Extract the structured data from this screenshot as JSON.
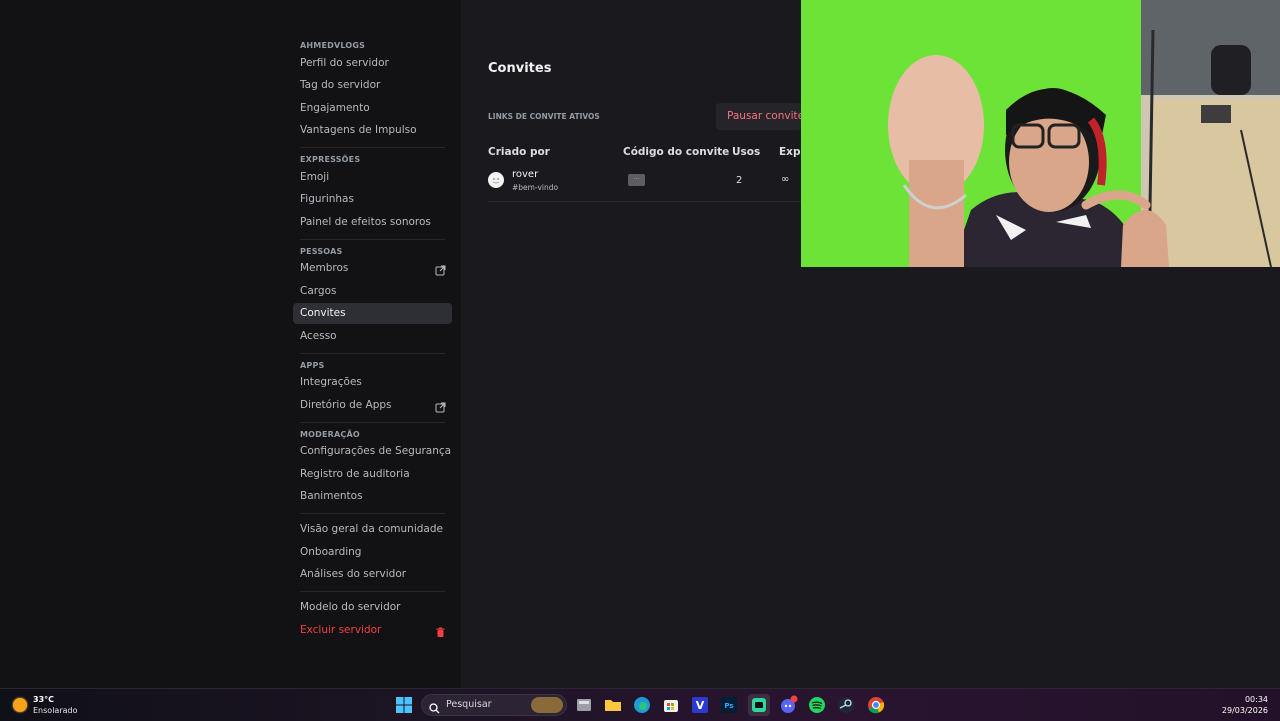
{
  "sidebar": {
    "sections": [
      {
        "header": "AHMEDVLOGS",
        "items": [
          {
            "label": "Perfil do servidor"
          },
          {
            "label": "Tag do servidor"
          },
          {
            "label": "Engajamento"
          },
          {
            "label": "Vantagens de Impulso"
          }
        ]
      },
      {
        "header": "EXPRESSÕES",
        "items": [
          {
            "label": "Emoji"
          },
          {
            "label": "Figurinhas"
          },
          {
            "label": "Painel de efeitos sonoros"
          }
        ]
      },
      {
        "header": "PESSOAS",
        "items": [
          {
            "label": "Membros",
            "trail_icon": "external-link-icon"
          },
          {
            "label": "Cargos"
          },
          {
            "label": "Convites",
            "active": true
          },
          {
            "label": "Acesso"
          }
        ]
      },
      {
        "header": "APPS",
        "items": [
          {
            "label": "Integrações"
          },
          {
            "label": "Diretório de Apps",
            "trail_icon": "external-link-icon"
          }
        ]
      },
      {
        "header": "MODERAÇÃO",
        "items": [
          {
            "label": "Configurações de Segurança"
          },
          {
            "label": "Registro de auditoria"
          },
          {
            "label": "Banimentos"
          }
        ]
      },
      {
        "header": "",
        "items": [
          {
            "label": "Visão geral da comunidade"
          },
          {
            "label": "Onboarding"
          },
          {
            "label": "Análises do servidor"
          }
        ]
      },
      {
        "header": "",
        "items": [
          {
            "label": "Modelo do servidor"
          },
          {
            "label": "Excluir servidor",
            "danger": true,
            "trail_icon": "trash-icon"
          }
        ]
      }
    ]
  },
  "main": {
    "title": "Convites",
    "links_label": "LINKS DE CONVITE ATIVOS",
    "pause_button": "Pausar convites",
    "columns": [
      "Criado por",
      "Código do convite",
      "Usos",
      "Expir"
    ],
    "rows": [
      {
        "creator": "rover",
        "channel": "#bem-vindo",
        "code_masked": "···",
        "uses": "2",
        "expires": "∞"
      }
    ]
  },
  "taskbar": {
    "weather_temp": "33°C",
    "weather_desc": "Ensolarado",
    "search_placeholder": "Pesquisar",
    "apps": [
      "windows-start-icon",
      "file-explorer-icon",
      "folder-icon",
      "edge-icon",
      "store-icon",
      "vegas-icon",
      "photoshop-icon",
      "capcut-icon",
      "discord-icon",
      "spotify-icon",
      "steam-icon",
      "chrome-icon"
    ],
    "time": "00:34",
    "date": "29/03/2026",
    "colors": {
      "accent_danger": "#f23f42",
      "weather_sun": "#f7a21b",
      "greenscreen": "#6ee337"
    }
  }
}
